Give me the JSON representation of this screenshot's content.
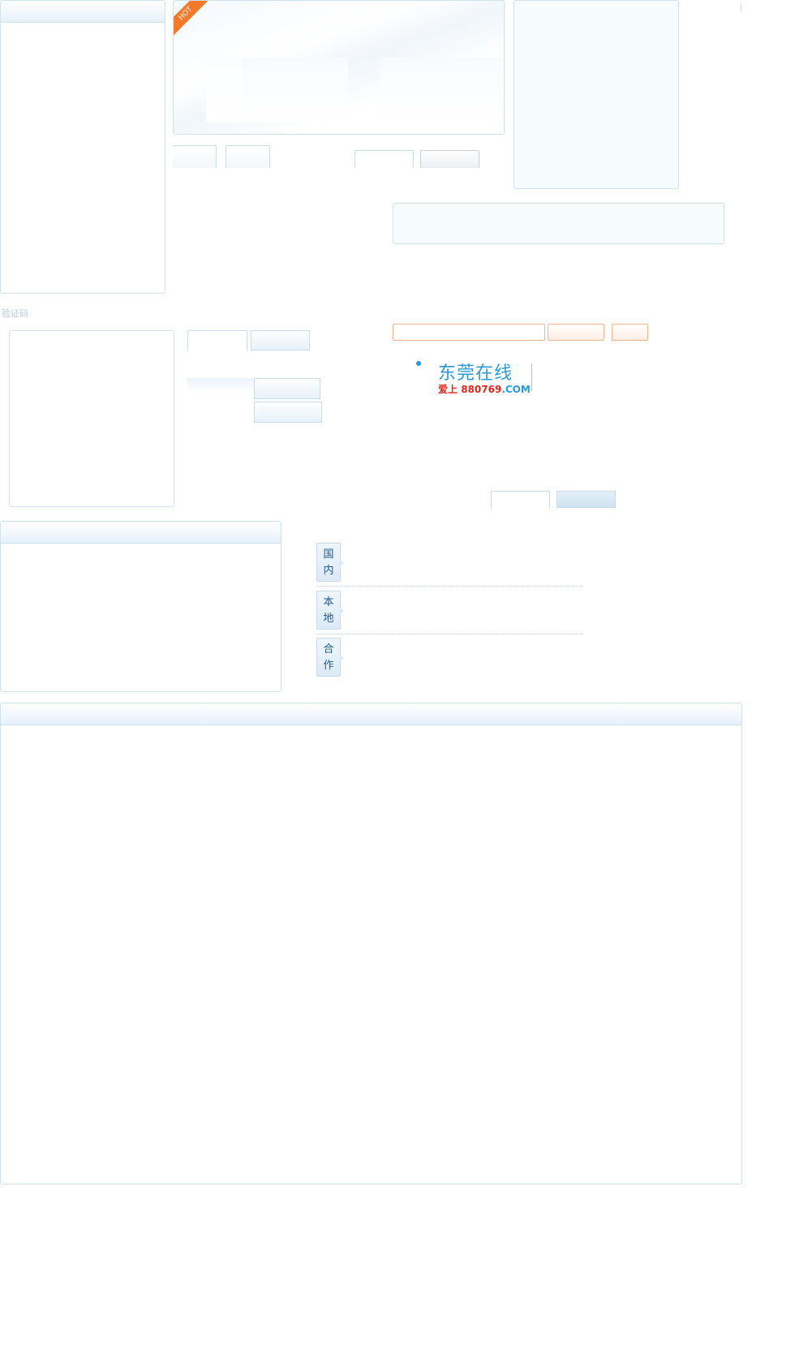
{
  "hot_badge": {
    "text": "HOT"
  },
  "verification": {
    "label": "验证码"
  },
  "logo": {
    "name": "东莞在线",
    "tagline_prefix": "爱上",
    "tagline_number": "880769",
    "tagline_suffix": ".COM"
  },
  "news_labels": [
    {
      "line1": "国",
      "line2": "内"
    },
    {
      "line1": "本",
      "line2": "地"
    },
    {
      "line1": "合",
      "line2": "作"
    }
  ],
  "colors": {
    "panel_border": "#cfe2f0",
    "accent_orange": "#f37a2a",
    "logo_red": "#e1251b",
    "logo_blue": "#2d9ad8"
  }
}
